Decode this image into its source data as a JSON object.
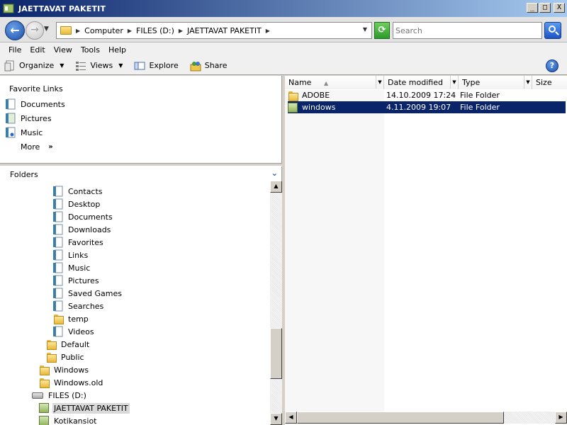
{
  "window": {
    "title": "JAETTAVAT PAKETIT"
  },
  "caption_buttons": {
    "minimize": "_",
    "maximize": "□",
    "close": "X"
  },
  "address": {
    "crumbs": [
      "Computer",
      "FILES (D:)",
      "JAETTAVAT PAKETIT"
    ],
    "search_placeholder": "Search"
  },
  "menu": {
    "items": [
      "File",
      "Edit",
      "View",
      "Tools",
      "Help"
    ]
  },
  "toolbar": {
    "organize": "Organize",
    "views": "Views",
    "explore": "Explore",
    "share": "Share"
  },
  "favorites": {
    "header": "Favorite Links",
    "items": [
      "Documents",
      "Pictures",
      "Music"
    ],
    "more": "More",
    "more_chevron": "»"
  },
  "folders": {
    "header": "Folders",
    "tree": [
      {
        "label": "Contacts",
        "icon": "contacts-icon"
      },
      {
        "label": "Desktop",
        "icon": "desktop-icon"
      },
      {
        "label": "Documents",
        "icon": "documents-icon"
      },
      {
        "label": "Downloads",
        "icon": "downloads-icon"
      },
      {
        "label": "Favorites",
        "icon": "favorites-icon"
      },
      {
        "label": "Links",
        "icon": "links-icon"
      },
      {
        "label": "Music",
        "icon": "music-icon"
      },
      {
        "label": "Pictures",
        "icon": "pictures-icon"
      },
      {
        "label": "Saved Games",
        "icon": "saved-games-icon"
      },
      {
        "label": "Searches",
        "icon": "searches-icon"
      },
      {
        "label": "temp",
        "icon": "folder-icon"
      },
      {
        "label": "Videos",
        "icon": "videos-icon"
      },
      {
        "label": "Default",
        "icon": "folder-icon"
      },
      {
        "label": "Public",
        "icon": "folder-icon"
      },
      {
        "label": "Windows",
        "icon": "folder-icon"
      },
      {
        "label": "Windows.old",
        "icon": "folder-icon"
      },
      {
        "label": "FILES (D:)",
        "icon": "drive-icon"
      },
      {
        "label": "JAETTAVAT PAKETIT",
        "icon": "shared-folder-icon",
        "selected": true
      },
      {
        "label": "Kotikansiot",
        "icon": "shared-folder-icon"
      }
    ]
  },
  "columns": {
    "name": "Name",
    "date": "Date modified",
    "type": "Type",
    "size": "Size"
  },
  "files": [
    {
      "name": "ADOBE",
      "date": "14.10.2009 17:24",
      "type": "File Folder"
    },
    {
      "name": "windows",
      "date": "4.11.2009 19:07",
      "type": "File Folder",
      "selected": true
    }
  ],
  "colors": {
    "selection": "#0a246a",
    "title_gradient_start": "#0a246a",
    "title_gradient_end": "#a6caf0"
  }
}
